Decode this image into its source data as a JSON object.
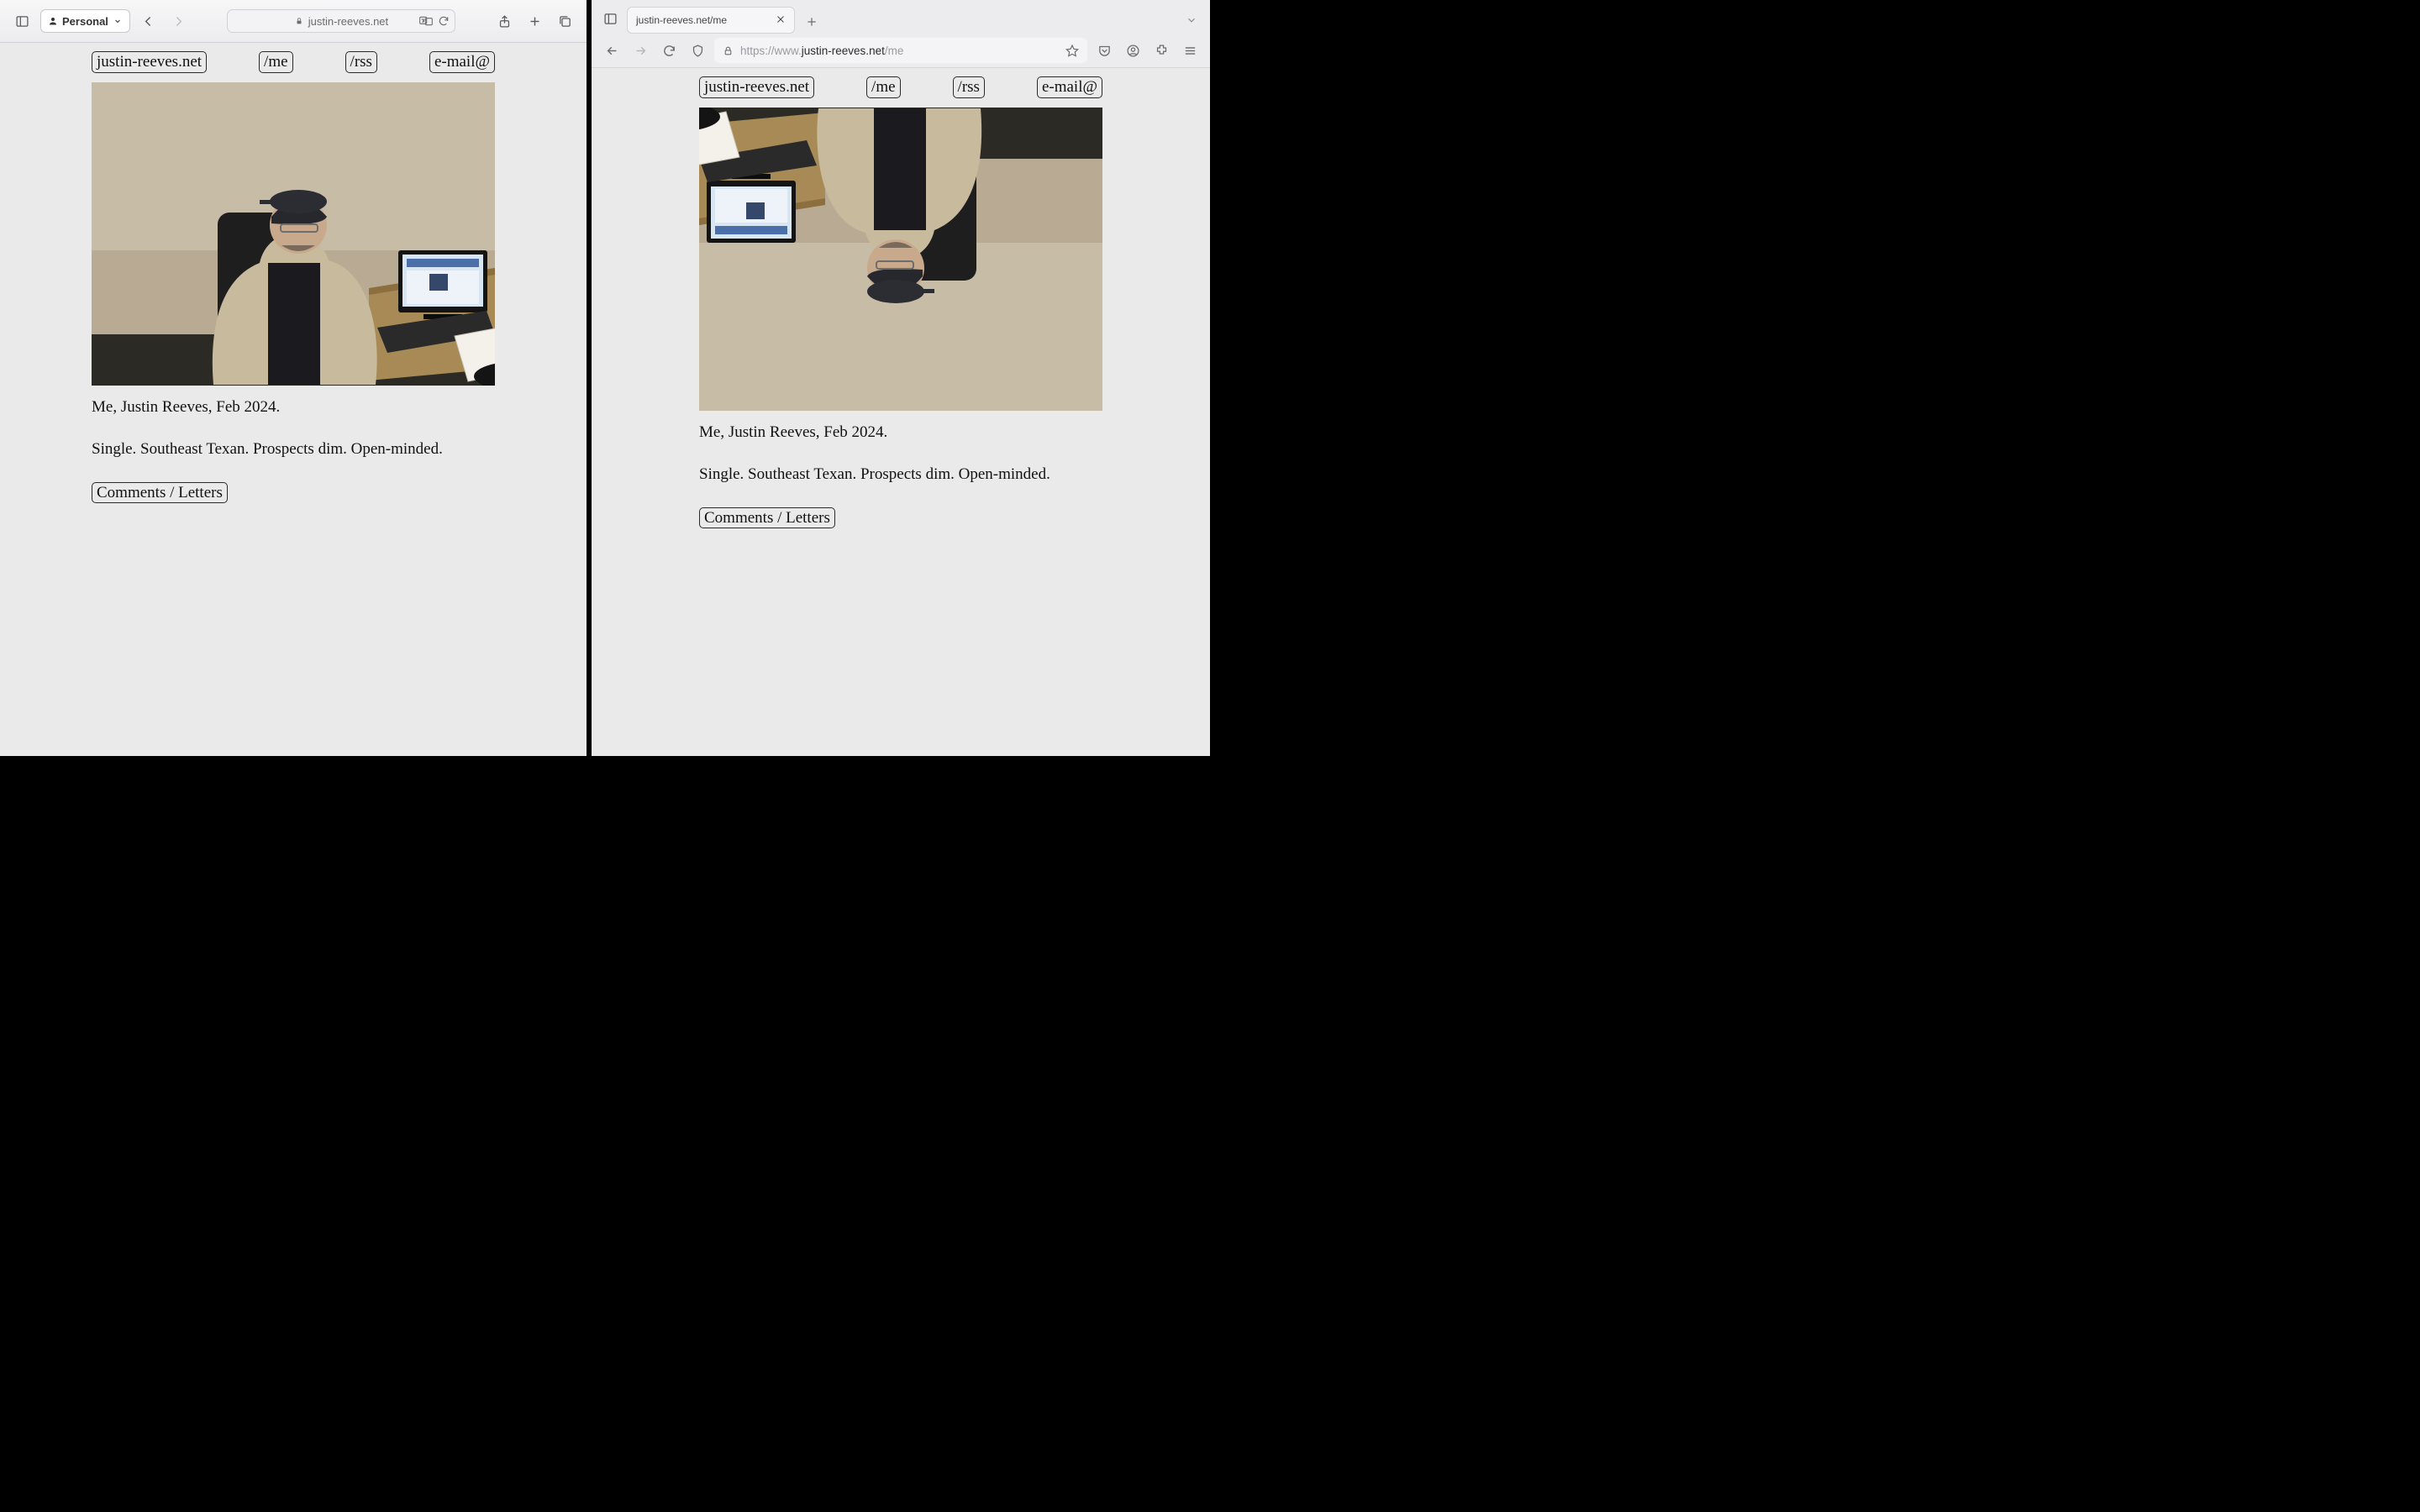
{
  "safari": {
    "profile_label": "Personal",
    "address": "justin-reeves.net"
  },
  "firefox": {
    "tab_title": "justin-reeves.net/me",
    "url_prefix": "https://www.",
    "url_domain": "justin-reeves.net",
    "url_path": "/me"
  },
  "page": {
    "nav": {
      "home": "justin-reeves.net",
      "me": "/me",
      "rss": "/rss",
      "email": "e-mail@"
    },
    "caption1": "Me, Justin Reeves, Feb 2024.",
    "caption2": "Single. Southeast Texan. Prospects dim. Open-minded.",
    "comments": "Comments / Letters"
  },
  "photo": {
    "alt": "Justin Reeves seated at a wooden desk wearing a tan hoodie and dark cap, with a small laptop, keyboard, mouse and printed papers on the desk",
    "rotated_right": true
  }
}
